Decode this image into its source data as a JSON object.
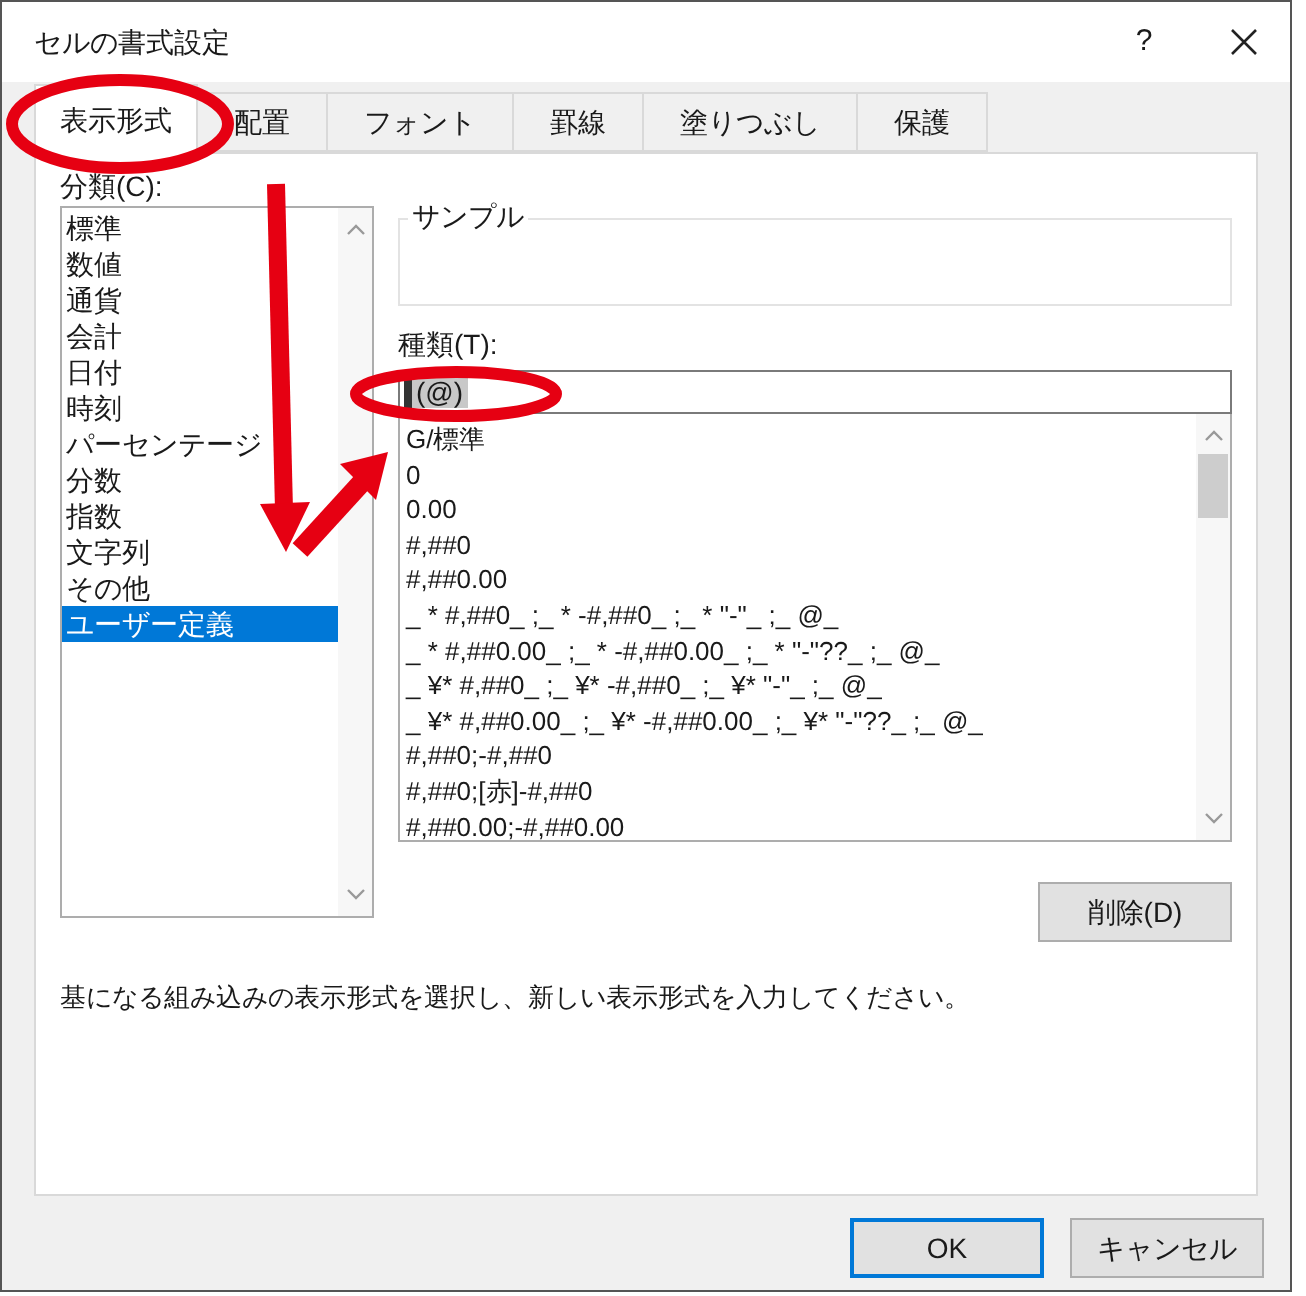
{
  "window": {
    "title": "セルの書式設定",
    "help": "?"
  },
  "tabs": [
    {
      "label": "表示形式",
      "selected": true
    },
    {
      "label": "配置",
      "selected": false
    },
    {
      "label": "フォント",
      "selected": false
    },
    {
      "label": "罫線",
      "selected": false
    },
    {
      "label": "塗りつぶし",
      "selected": false
    },
    {
      "label": "保護",
      "selected": false
    }
  ],
  "category": {
    "label": "分類(C):",
    "items": [
      {
        "label": "標準",
        "selected": false
      },
      {
        "label": "数値",
        "selected": false
      },
      {
        "label": "通貨",
        "selected": false
      },
      {
        "label": "会計",
        "selected": false
      },
      {
        "label": "日付",
        "selected": false
      },
      {
        "label": "時刻",
        "selected": false
      },
      {
        "label": "パーセンテージ",
        "selected": false
      },
      {
        "label": "分数",
        "selected": false
      },
      {
        "label": "指数",
        "selected": false
      },
      {
        "label": "文字列",
        "selected": false
      },
      {
        "label": "その他",
        "selected": false
      },
      {
        "label": "ユーザー定義",
        "selected": true
      }
    ]
  },
  "sample": {
    "label": "サンプル"
  },
  "type": {
    "label": "種類(T):",
    "value": "(@)",
    "formats": [
      "G/標準",
      "0",
      "0.00",
      "#,##0",
      "#,##0.00",
      "_ * #,##0_ ;_ * -#,##0_ ;_ * \"-\"_ ;_ @_",
      "_ * #,##0.00_ ;_ * -#,##0.00_ ;_ * \"-\"??_ ;_ @_",
      "_ ¥* #,##0_ ;_ ¥* -#,##0_ ;_ ¥* \"-\"_ ;_ @_",
      "_ ¥* #,##0.00_ ;_ ¥* -#,##0.00_ ;_ ¥* \"-\"??_ ;_ @_",
      "#,##0;-#,##0",
      "#,##0;[赤]-#,##0",
      "#,##0.00;-#,##0.00"
    ]
  },
  "delete_button": "削除(D)",
  "description": "基になる組み込みの表示形式を選択し、新しい表示形式を入力してください。",
  "buttons": [
    {
      "label": "OK",
      "kind": "default"
    },
    {
      "label": "キャンセル",
      "kind": "normal"
    }
  ]
}
